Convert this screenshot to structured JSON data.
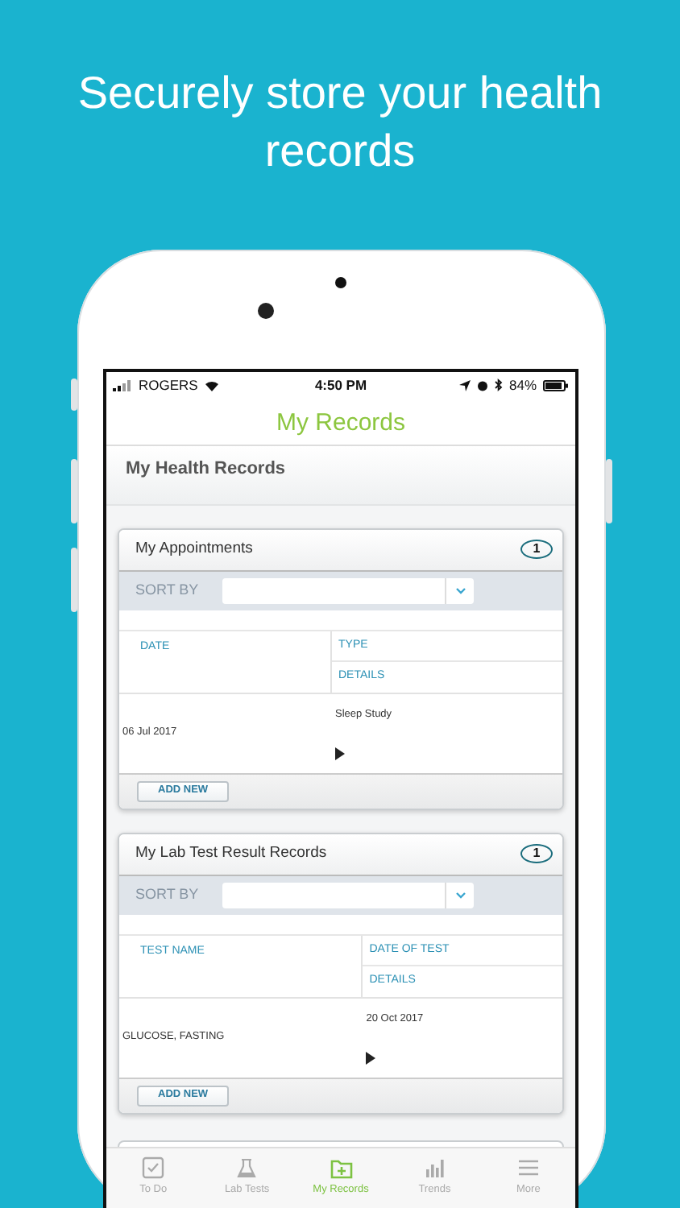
{
  "headline": "Securely store your health records",
  "status_bar": {
    "carrier": "ROGERS",
    "time": "4:50 PM",
    "battery": "84%"
  },
  "title": "My Records",
  "section_title": "My Health Records",
  "cards": [
    {
      "title": "My Appointments",
      "count": "1",
      "sort_label": "SORT BY",
      "left_heading": "DATE",
      "right_headings": [
        "TYPE",
        "DETAILS"
      ],
      "rows": [
        {
          "left": "06 Jul 2017",
          "right": "Sleep Study"
        }
      ],
      "button": "ADD NEW"
    },
    {
      "title": "My Lab Test Result Records",
      "count": "1",
      "sort_label": "SORT BY",
      "left_heading": "TEST NAME",
      "right_headings": [
        "DATE OF TEST",
        "DETAILS"
      ],
      "rows": [
        {
          "left": "GLUCOSE, FASTING",
          "right": "20 Oct 2017"
        }
      ],
      "button": "ADD NEW"
    }
  ],
  "tabs": [
    {
      "label": "To Do",
      "selected": false
    },
    {
      "label": "Lab Tests",
      "selected": false
    },
    {
      "label": "My Records",
      "selected": true
    },
    {
      "label": "Trends",
      "selected": false
    },
    {
      "label": "More",
      "selected": false
    }
  ]
}
